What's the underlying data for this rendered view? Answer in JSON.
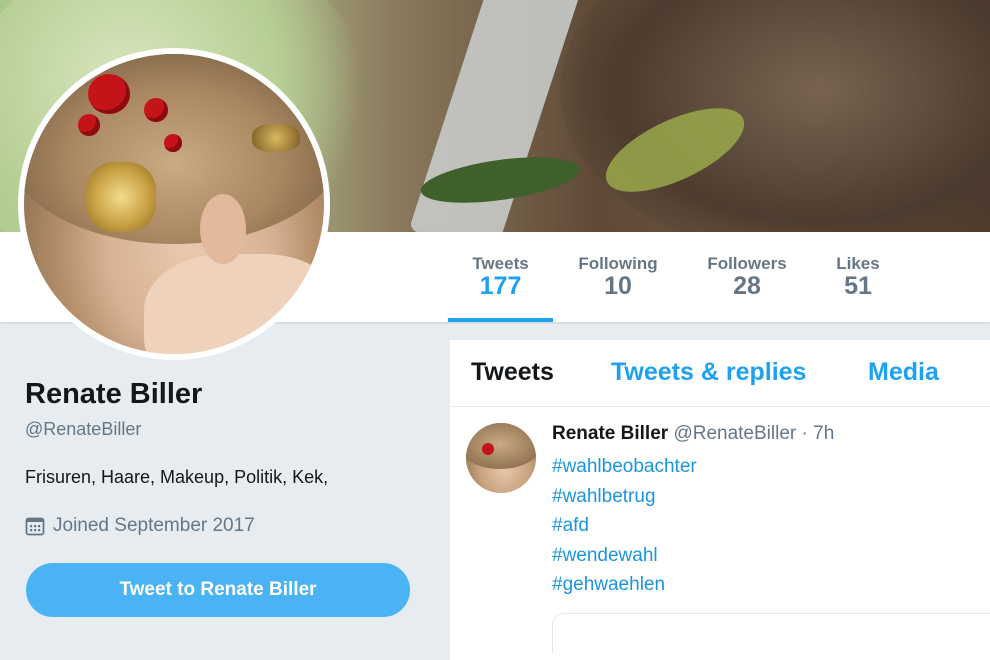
{
  "profile": {
    "name": "Renate Biller",
    "handle": "@RenateBiller",
    "bio": "Frisuren, Haare, Makeup, Politik, Kek,",
    "joined": "Joined September 2017",
    "tweet_to_label": "Tweet to Renate Biller"
  },
  "stats": [
    {
      "label": "Tweets",
      "value": "177",
      "active": true
    },
    {
      "label": "Following",
      "value": "10",
      "active": false
    },
    {
      "label": "Followers",
      "value": "28",
      "active": false
    },
    {
      "label": "Likes",
      "value": "51",
      "active": false
    }
  ],
  "timeline": {
    "tabs": [
      "Tweets",
      "Tweets & replies",
      "Media"
    ],
    "active_tab": "Tweets"
  },
  "tweet": {
    "author": "Renate Biller",
    "handle": "@RenateBiller",
    "time": "· 7h",
    "hashtags": [
      "#wahlbeobachter",
      "#wahlbetrug",
      "#afd",
      "#wendewahl",
      "#gehwaehlen"
    ]
  },
  "colors": {
    "accent": "#1da1f2",
    "button": "#4ab3f4",
    "muted": "#657786",
    "background": "#e6ecf0"
  },
  "icons": {
    "joined": "calendar-icon"
  }
}
